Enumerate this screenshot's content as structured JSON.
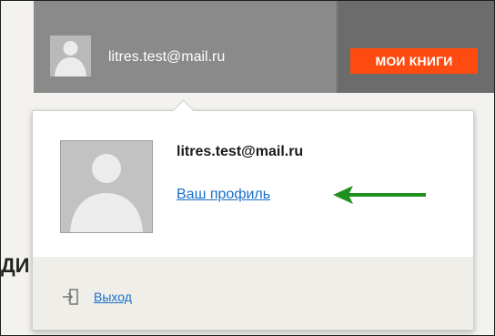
{
  "header": {
    "user_email": "litres.test@mail.ru",
    "my_books_label": "МОИ КНИГИ"
  },
  "background": {
    "partial_text": "ДИ"
  },
  "popup": {
    "email": "litres.test@mail.ru",
    "profile_link": "Ваш профиль",
    "logout_link": "Выход"
  },
  "colors": {
    "header_bg": "#8a8a8a",
    "button_bg": "#ff4b10",
    "link": "#1a6fc9",
    "arrow": "#1f8f1f"
  },
  "icons": {
    "avatar": "avatar-silhouette-icon",
    "arrow": "left-arrow-icon",
    "logout": "logout-icon"
  }
}
